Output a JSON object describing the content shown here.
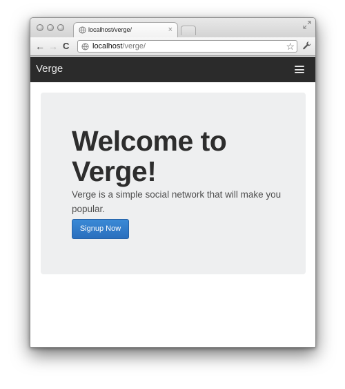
{
  "browser": {
    "tab": {
      "title": "localhost/verge/",
      "close_glyph": "×"
    },
    "toolbar": {
      "back_glyph": "←",
      "forward_glyph": "→",
      "reload_glyph": "C",
      "url_host": "localhost",
      "url_path": "/verge/",
      "star_glyph": "☆"
    },
    "icons": [
      "globe-icon",
      "close-icon",
      "fullscreen-icon",
      "back-arrow-icon",
      "forward-arrow-icon",
      "reload-icon",
      "star-icon",
      "wrench-icon"
    ]
  },
  "page": {
    "navbar": {
      "brand": "Verge",
      "menu_icon": "hamburger-icon"
    },
    "jumbotron": {
      "title": "Welcome to Verge!",
      "lead": "Verge is a simple social network that will make you popular.",
      "button_label": "Signup Now"
    }
  },
  "colors": {
    "navbar_bg": "#2b2b2b",
    "jumbotron_bg": "#eeeff0",
    "button_blue": "#2a6fbd",
    "title_text": "#2d2d2d"
  }
}
